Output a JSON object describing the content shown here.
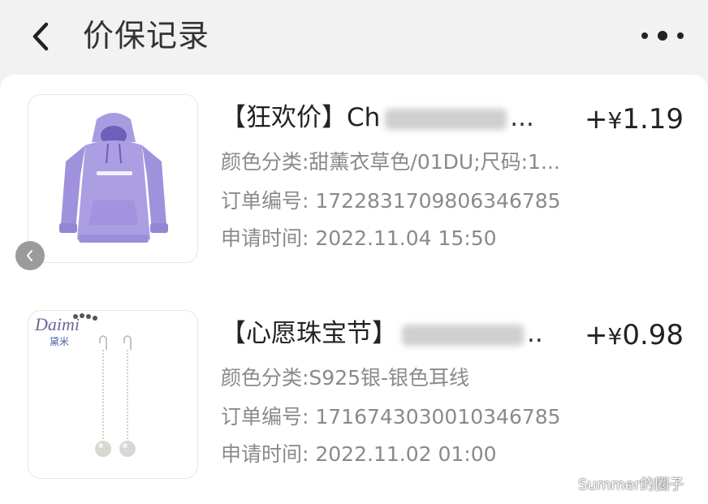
{
  "header": {
    "title": "价保记录",
    "back_icon": "chevron-left-icon",
    "more_icon": "more-dots-icon"
  },
  "records": [
    {
      "title": "【狂欢价】Ch",
      "price_sign": "+",
      "currency": "¥",
      "amount": "1.19",
      "spec": "颜色分类:甜薰衣草色/01DU;尺码:1...",
      "order": "订单编号: 1722831709806346785",
      "time": "申请时间: 2022.11.04 15:50",
      "image": "lavender-hoodie"
    },
    {
      "title": "【心愿珠宝节】",
      "price_sign": "+",
      "currency": "¥",
      "amount": "0.98",
      "spec": "颜色分类:S925银-银色耳线",
      "order": "订单编号: 1716743030010346785",
      "time": "申请时间: 2022.11.02 01:00",
      "image": "pearl-earrings",
      "logo_text": "Daimi",
      "logo_sub": "黛米"
    }
  ],
  "watermark": "Summer的圈子",
  "colors": {
    "page_bg": "#f2f2f2",
    "card_bg": "#ffffff",
    "text_primary": "#222222",
    "text_secondary": "#8a8a8a",
    "hoodie": "#a99be0"
  }
}
